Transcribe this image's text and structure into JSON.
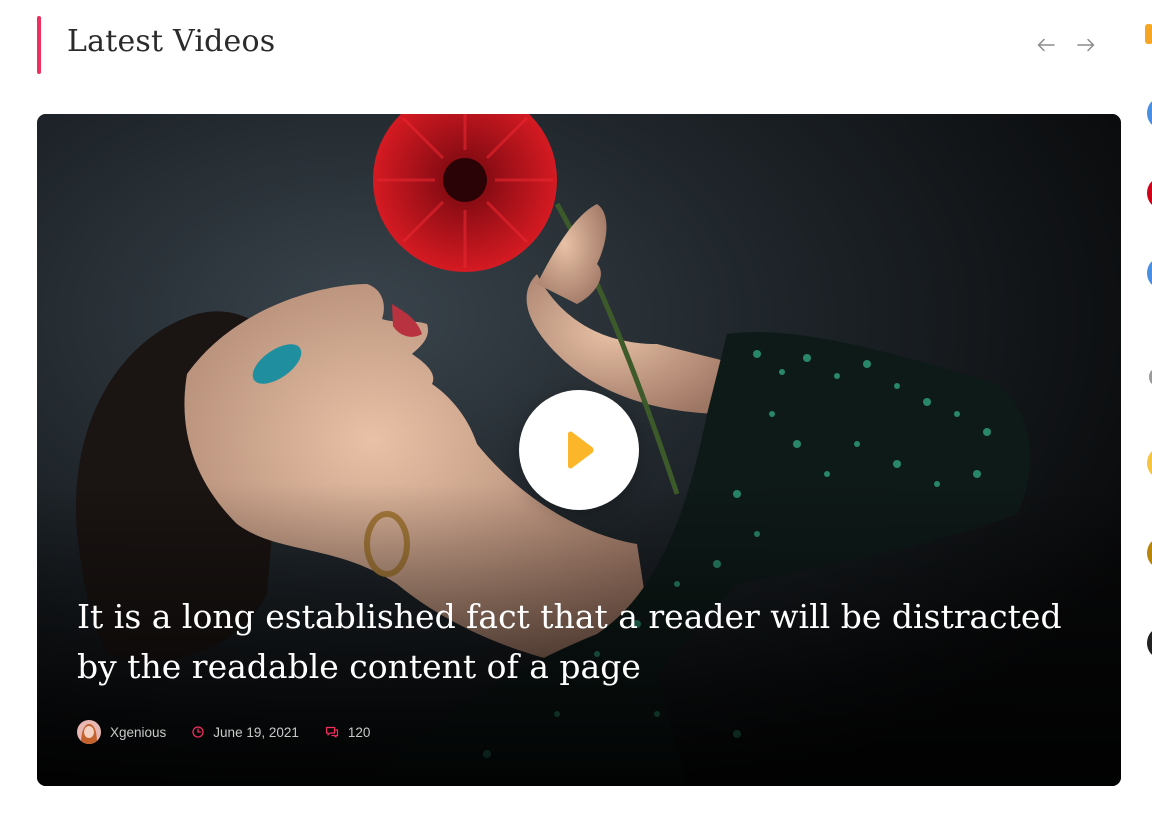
{
  "section": {
    "title": "Latest Videos",
    "accent_color": "#ee2f5f",
    "prev_icon": "arrow-left-icon",
    "next_icon": "arrow-right-icon"
  },
  "video": {
    "title": "It is a long established fact that a reader will be distracted by the readable content of a page",
    "play_icon": "play-icon",
    "play_color": "#fbb629",
    "author": "Xgenious",
    "date": "June 19, 2021",
    "comments": "120",
    "meta_icon_color": "#ee2f5f"
  },
  "sidebar_peek_colors": [
    "#f5a623",
    "#4a90e2",
    "#d0021b",
    "#4a90e2",
    "#9b9b9b",
    "#f5c542",
    "#b8860b",
    "#222222"
  ]
}
